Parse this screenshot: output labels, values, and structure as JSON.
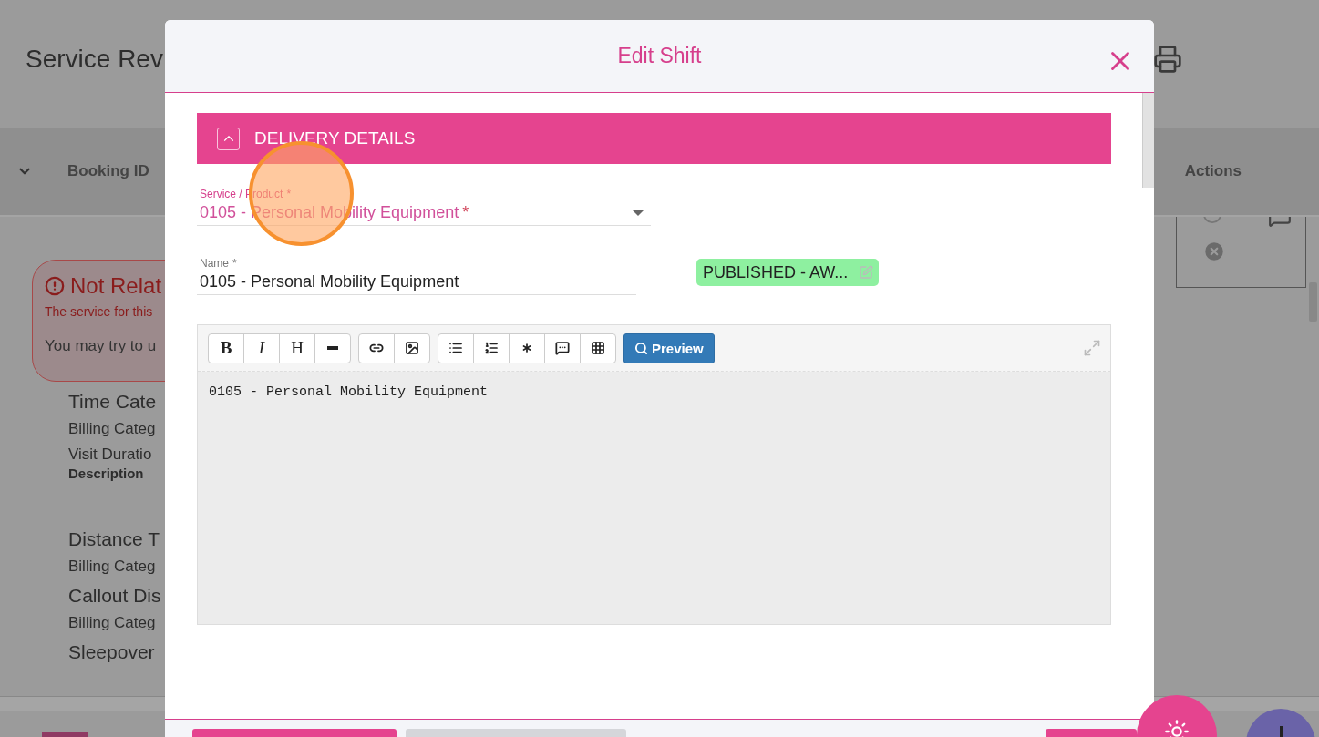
{
  "background_page": {
    "title": "Service Rev",
    "table_header": {
      "columns": [
        "Booking ID",
        "Actions"
      ]
    },
    "alert": {
      "title": "Not Relat",
      "message": "The service for this",
      "hint": "You may try to u"
    },
    "items": [
      {
        "kind": "heading",
        "text": "Time Cate"
      },
      {
        "kind": "line",
        "text": "Billing Categ"
      },
      {
        "kind": "line",
        "text": "Visit Duratio"
      },
      {
        "kind": "label",
        "text": "Description"
      },
      {
        "kind": "heading",
        "text": "Distance T"
      },
      {
        "kind": "line",
        "text": "Billing Categ"
      },
      {
        "kind": "heading",
        "text": "Callout Dis"
      },
      {
        "kind": "line",
        "text": "Billing Categ"
      },
      {
        "kind": "heading",
        "text": "Sleepover"
      }
    ]
  },
  "dialog": {
    "title": "Edit Shift",
    "section": {
      "title": "DELIVERY DETAILS",
      "expanded": true
    },
    "service_field": {
      "label": "Service / Product",
      "label_mark": "*",
      "value": "0105 - Personal Mobility Equipment",
      "value_mark": "*"
    },
    "name_field": {
      "label": "Name",
      "label_mark": "*",
      "value": "0105 - Personal Mobility Equipment"
    },
    "status_badge": {
      "text": "PUBLISHED - AW..."
    },
    "editor": {
      "toolbar": [
        [
          {
            "kind": "bold",
            "label": "B"
          },
          {
            "kind": "italic",
            "label": "I"
          },
          {
            "kind": "heading",
            "label": "H"
          },
          {
            "kind": "rule"
          }
        ],
        [
          {
            "kind": "link"
          },
          {
            "kind": "image"
          }
        ],
        [
          {
            "kind": "bullet-list"
          },
          {
            "kind": "numbered-list"
          },
          {
            "kind": "asterisk"
          },
          {
            "kind": "comment"
          },
          {
            "kind": "grid"
          }
        ]
      ],
      "preview_button": "Preview",
      "content": "0105 - Personal Mobility Equipment"
    },
    "footer_buttons": [
      {
        "kind": "primary"
      },
      {
        "kind": "secondary"
      },
      {
        "kind": "primary"
      }
    ]
  }
}
